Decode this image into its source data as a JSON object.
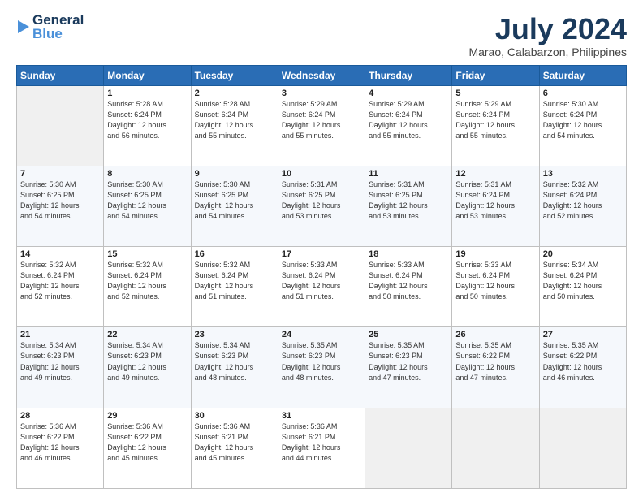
{
  "header": {
    "logo_general": "General",
    "logo_blue": "Blue",
    "main_title": "July 2024",
    "subtitle": "Marao, Calabarzon, Philippines"
  },
  "weekdays": [
    "Sunday",
    "Monday",
    "Tuesday",
    "Wednesday",
    "Thursday",
    "Friday",
    "Saturday"
  ],
  "weeks": [
    [
      {
        "day": "",
        "info": ""
      },
      {
        "day": "1",
        "info": "Sunrise: 5:28 AM\nSunset: 6:24 PM\nDaylight: 12 hours\nand 56 minutes."
      },
      {
        "day": "2",
        "info": "Sunrise: 5:28 AM\nSunset: 6:24 PM\nDaylight: 12 hours\nand 55 minutes."
      },
      {
        "day": "3",
        "info": "Sunrise: 5:29 AM\nSunset: 6:24 PM\nDaylight: 12 hours\nand 55 minutes."
      },
      {
        "day": "4",
        "info": "Sunrise: 5:29 AM\nSunset: 6:24 PM\nDaylight: 12 hours\nand 55 minutes."
      },
      {
        "day": "5",
        "info": "Sunrise: 5:29 AM\nSunset: 6:24 PM\nDaylight: 12 hours\nand 55 minutes."
      },
      {
        "day": "6",
        "info": "Sunrise: 5:30 AM\nSunset: 6:24 PM\nDaylight: 12 hours\nand 54 minutes."
      }
    ],
    [
      {
        "day": "7",
        "info": "Sunrise: 5:30 AM\nSunset: 6:25 PM\nDaylight: 12 hours\nand 54 minutes."
      },
      {
        "day": "8",
        "info": "Sunrise: 5:30 AM\nSunset: 6:25 PM\nDaylight: 12 hours\nand 54 minutes."
      },
      {
        "day": "9",
        "info": "Sunrise: 5:30 AM\nSunset: 6:25 PM\nDaylight: 12 hours\nand 54 minutes."
      },
      {
        "day": "10",
        "info": "Sunrise: 5:31 AM\nSunset: 6:25 PM\nDaylight: 12 hours\nand 53 minutes."
      },
      {
        "day": "11",
        "info": "Sunrise: 5:31 AM\nSunset: 6:25 PM\nDaylight: 12 hours\nand 53 minutes."
      },
      {
        "day": "12",
        "info": "Sunrise: 5:31 AM\nSunset: 6:24 PM\nDaylight: 12 hours\nand 53 minutes."
      },
      {
        "day": "13",
        "info": "Sunrise: 5:32 AM\nSunset: 6:24 PM\nDaylight: 12 hours\nand 52 minutes."
      }
    ],
    [
      {
        "day": "14",
        "info": "Sunrise: 5:32 AM\nSunset: 6:24 PM\nDaylight: 12 hours\nand 52 minutes."
      },
      {
        "day": "15",
        "info": "Sunrise: 5:32 AM\nSunset: 6:24 PM\nDaylight: 12 hours\nand 52 minutes."
      },
      {
        "day": "16",
        "info": "Sunrise: 5:32 AM\nSunset: 6:24 PM\nDaylight: 12 hours\nand 51 minutes."
      },
      {
        "day": "17",
        "info": "Sunrise: 5:33 AM\nSunset: 6:24 PM\nDaylight: 12 hours\nand 51 minutes."
      },
      {
        "day": "18",
        "info": "Sunrise: 5:33 AM\nSunset: 6:24 PM\nDaylight: 12 hours\nand 50 minutes."
      },
      {
        "day": "19",
        "info": "Sunrise: 5:33 AM\nSunset: 6:24 PM\nDaylight: 12 hours\nand 50 minutes."
      },
      {
        "day": "20",
        "info": "Sunrise: 5:34 AM\nSunset: 6:24 PM\nDaylight: 12 hours\nand 50 minutes."
      }
    ],
    [
      {
        "day": "21",
        "info": "Sunrise: 5:34 AM\nSunset: 6:23 PM\nDaylight: 12 hours\nand 49 minutes."
      },
      {
        "day": "22",
        "info": "Sunrise: 5:34 AM\nSunset: 6:23 PM\nDaylight: 12 hours\nand 49 minutes."
      },
      {
        "day": "23",
        "info": "Sunrise: 5:34 AM\nSunset: 6:23 PM\nDaylight: 12 hours\nand 48 minutes."
      },
      {
        "day": "24",
        "info": "Sunrise: 5:35 AM\nSunset: 6:23 PM\nDaylight: 12 hours\nand 48 minutes."
      },
      {
        "day": "25",
        "info": "Sunrise: 5:35 AM\nSunset: 6:23 PM\nDaylight: 12 hours\nand 47 minutes."
      },
      {
        "day": "26",
        "info": "Sunrise: 5:35 AM\nSunset: 6:22 PM\nDaylight: 12 hours\nand 47 minutes."
      },
      {
        "day": "27",
        "info": "Sunrise: 5:35 AM\nSunset: 6:22 PM\nDaylight: 12 hours\nand 46 minutes."
      }
    ],
    [
      {
        "day": "28",
        "info": "Sunrise: 5:36 AM\nSunset: 6:22 PM\nDaylight: 12 hours\nand 46 minutes."
      },
      {
        "day": "29",
        "info": "Sunrise: 5:36 AM\nSunset: 6:22 PM\nDaylight: 12 hours\nand 45 minutes."
      },
      {
        "day": "30",
        "info": "Sunrise: 5:36 AM\nSunset: 6:21 PM\nDaylight: 12 hours\nand 45 minutes."
      },
      {
        "day": "31",
        "info": "Sunrise: 5:36 AM\nSunset: 6:21 PM\nDaylight: 12 hours\nand 44 minutes."
      },
      {
        "day": "",
        "info": ""
      },
      {
        "day": "",
        "info": ""
      },
      {
        "day": "",
        "info": ""
      }
    ]
  ]
}
